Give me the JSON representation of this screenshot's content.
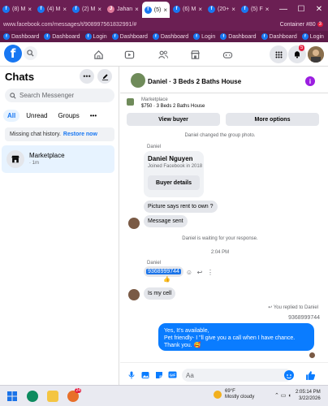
{
  "browser": {
    "tabs": [
      {
        "label": "(8) M",
        "active": false
      },
      {
        "label": "(4) M",
        "active": false
      },
      {
        "label": "(2) M",
        "active": false
      },
      {
        "label": "Jahan",
        "active": false
      },
      {
        "label": "(5)",
        "active": true
      },
      {
        "label": "(6) M",
        "active": false
      },
      {
        "label": "(20+",
        "active": false
      },
      {
        "label": "(5) F",
        "active": false
      }
    ],
    "url": "www.facebook.com/messages/t/908997561832991/#",
    "container_label": "Container #80",
    "container_badge": "3",
    "bookmarks": [
      "Dashboard",
      "Dashboard",
      "Login",
      "Dashboard",
      "Dashboard",
      "Login",
      "Dashboard",
      "Dashboard",
      "Login"
    ]
  },
  "fbnav": {
    "logo": "f",
    "notifications_count": "5"
  },
  "sidebar": {
    "title": "Chats",
    "search_placeholder": "Search Messenger",
    "filters": [
      "All",
      "Unread",
      "Groups"
    ],
    "missing_text": "Missing chat history.",
    "restore_link": "Restore now",
    "chat_item": {
      "name": "Marketplace",
      "time": "· 1m"
    }
  },
  "conversation": {
    "title": "Daniel · 3 Beds 2 Baths House",
    "listing_source": "Marketplace",
    "listing_price": "$750 · 3 Beds 2 Baths House",
    "view_buyer": "View buyer",
    "more_options": "More options",
    "messages": {
      "changed_photo": "Daniel changed the group photo.",
      "sender1": "Daniel",
      "card_name": "Daniel Nguyen",
      "card_joined": "Joined Facebook in 2018",
      "buyer_details": "Buyer details",
      "q1": "Picture says rent to own ?",
      "q2": "Message sent",
      "waiting": "Daniel is waiting for your response.",
      "time": "2:04 PM",
      "sender2": "Daniel",
      "phone": "9368999744",
      "thumb": "👍",
      "is_my_cell": "Is my cell",
      "replied": "You replied to Daniel",
      "quoted": "9368999744",
      "my_reply_line1": "Yes, It's available,",
      "my_reply_line2": "Pet friendly- I \"ll give you a call when I have chance. Thank you. 🥰"
    },
    "composer_placeholder": "Aa"
  },
  "taskbar": {
    "temp": "69°F",
    "weather": "Mostly cloudy",
    "time": "2:05:14 PM",
    "date": "3/22/2026"
  }
}
